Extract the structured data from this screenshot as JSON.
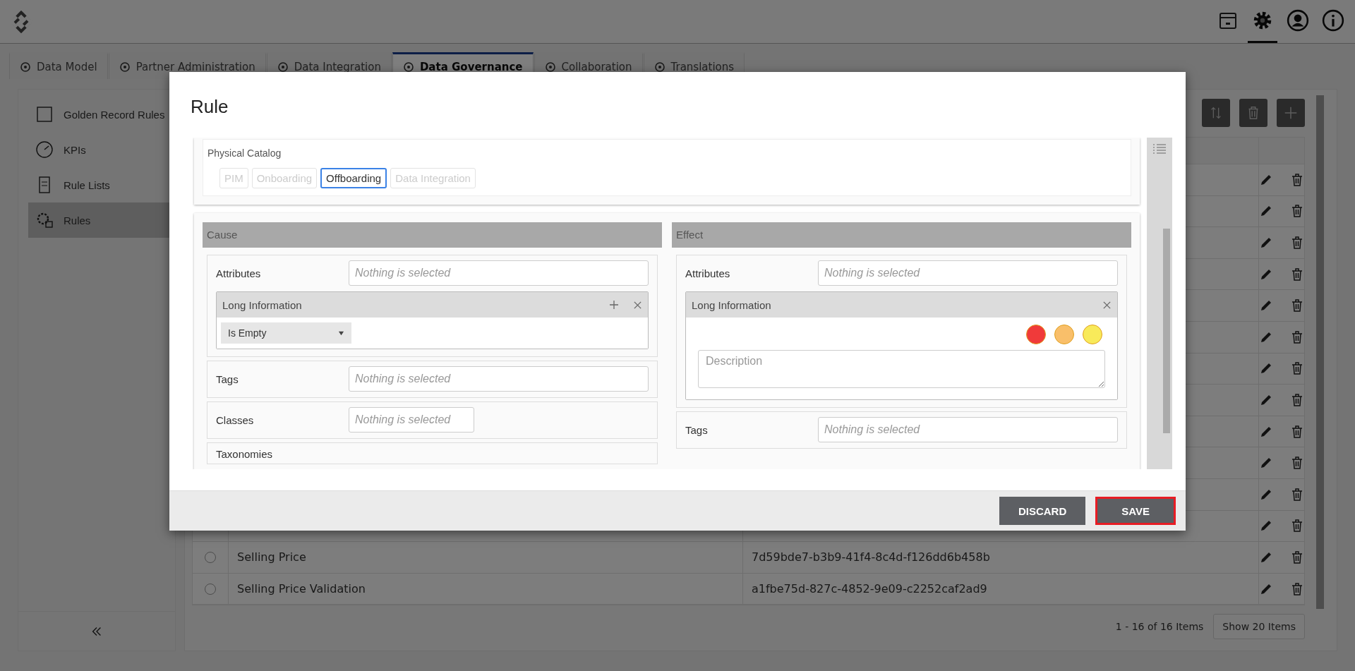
{
  "header_icons": [
    {
      "kind": "box",
      "selected": false
    },
    {
      "kind": "settings",
      "selected": true
    },
    {
      "kind": "user",
      "selected": false
    },
    {
      "kind": "info",
      "selected": false
    }
  ],
  "tabs": [
    {
      "label": "Data Model",
      "selected": false
    },
    {
      "label": "Partner Administration",
      "selected": false
    },
    {
      "label": "Data Integration",
      "selected": false
    },
    {
      "label": "Data Governance",
      "selected": true
    },
    {
      "label": "Collaboration",
      "selected": false
    },
    {
      "label": "Translations",
      "selected": false
    }
  ],
  "sidebar": {
    "items": [
      {
        "label": "Golden Record Rules",
        "selected": false
      },
      {
        "label": "KPIs",
        "selected": false
      },
      {
        "label": "Rule Lists",
        "selected": false
      },
      {
        "label": "Rules",
        "selected": true
      }
    ]
  },
  "table": {
    "rows": [
      {},
      {},
      {},
      {},
      {},
      {},
      {},
      {},
      {},
      {},
      {},
      {},
      {
        "name": "Selling Price",
        "selected": false,
        "id": "7d59bde7-b3b9-41f4-8c4d-f126dd6b458b"
      },
      {
        "name": "Selling Price Validation",
        "selected": false,
        "id": "a1fbe75d-827c-4852-9e09-c2252caf2ad9"
      }
    ]
  },
  "pagination": {
    "summary": "1 - 16 of 16 Items",
    "page_size_button": "Show 20 Items"
  },
  "modal": {
    "title": "Rule",
    "physical_catalog": {
      "label": "Physical Catalog",
      "options": [
        {
          "label": "PIM",
          "selected": false
        },
        {
          "label": "Onboarding",
          "selected": false
        },
        {
          "label": "Offboarding",
          "selected": true
        },
        {
          "label": "Data Integration",
          "selected": false
        }
      ]
    },
    "cause": {
      "title": "Cause",
      "attributes": {
        "label": "Attributes",
        "placeholder": "Nothing is selected"
      },
      "condition": {
        "title": "Long Information",
        "operator": "Is Empty"
      },
      "tags": {
        "label": "Tags",
        "placeholder": "Nothing is selected"
      },
      "classes": {
        "label": "Classes",
        "placeholder": "Nothing is selected"
      },
      "taxonomies": {
        "label": "Taxonomies"
      }
    },
    "effect": {
      "title": "Effect",
      "attributes": {
        "label": "Attributes",
        "placeholder": "Nothing is selected"
      },
      "action": {
        "title": "Long Information",
        "severities": [
          {
            "color": "#f03a3a"
          },
          {
            "color": "#f9bf6a"
          },
          {
            "color": "#f8ea5a"
          }
        ],
        "description_placeholder": "Description"
      },
      "tags": {
        "label": "Tags",
        "placeholder": "Nothing is selected"
      }
    },
    "buttons": [
      {
        "label": "DISCARD",
        "highlighted": false
      },
      {
        "label": "SAVE",
        "highlighted": true
      }
    ]
  }
}
